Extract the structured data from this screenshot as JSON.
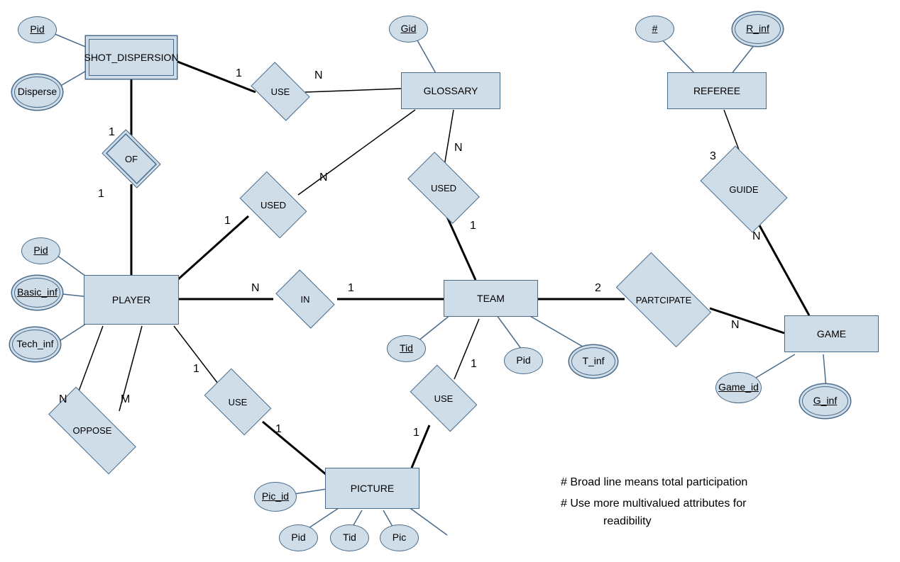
{
  "entities": {
    "shot_dispersion": "SHOT_DISPERSION",
    "glossary": "GLOSSARY",
    "referee": "REFEREE",
    "player": "PLAYER",
    "team": "TEAM",
    "game": "GAME",
    "picture": "PICTURE"
  },
  "relationships": {
    "use_sd": "USE",
    "of": "OF",
    "used_pg": "USED",
    "used_tg": "USED",
    "in": "IN",
    "guide": "GUIDE",
    "participate": "PARTCIPATE",
    "oppose": "OPPOSE",
    "use_pp": "USE",
    "use_tp": "USE"
  },
  "attributes": {
    "sd_pid": "Pid",
    "disperse": "Disperse",
    "gid": "Gid",
    "ref_num": "#",
    "r_inf": "R_inf",
    "p_pid": "Pid",
    "basic_inf": "Basic_inf",
    "tech_inf": "Tech_inf",
    "tid": "Tid",
    "t_pid": "Pid",
    "t_inf": "T_inf",
    "game_id": "Game_id",
    "g_inf": "G_inf",
    "pic_id": "Pic_id",
    "pic_pid": "Pid",
    "pic_tid": "Tid",
    "pic": "Pic"
  },
  "cardinalities": {
    "sd_use_1": "1",
    "sd_use_n": "N",
    "of_top_1": "1",
    "of_bot_1": "1",
    "used_pg_n": "N",
    "used_pg_1": "1",
    "used_tg_n": "N",
    "used_tg_1": "1",
    "in_n": "N",
    "in_1": "1",
    "part_2": "2",
    "part_n": "N",
    "guide_3": "3",
    "guide_n": "N",
    "oppose_n": "N",
    "oppose_m": "M",
    "use_pp_1a": "1",
    "use_pp_1b": "1",
    "use_tp_1a": "1",
    "use_tp_1b": "1"
  },
  "notes": {
    "line1": "# Broad line means  total participation",
    "line2": "# Use more multivalued attributes for",
    "line3": "readibility"
  }
}
